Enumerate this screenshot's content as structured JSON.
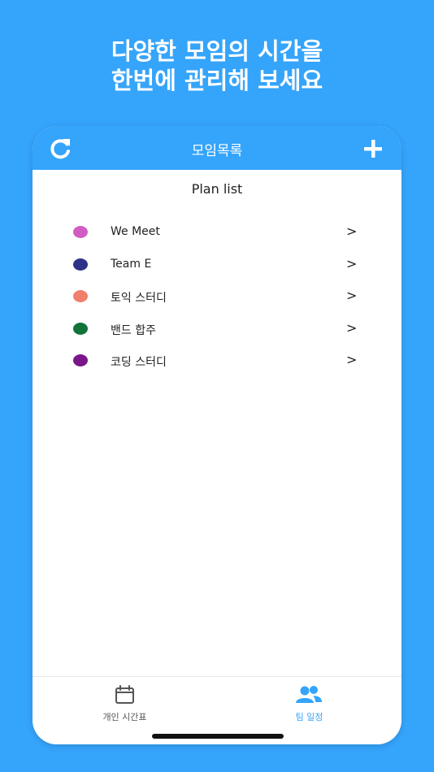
{
  "promo": {
    "line1": "다양한 모임의 시간을",
    "line2": "한번에 관리해 보세요"
  },
  "header": {
    "title": "모임목록",
    "left_icon": "refresh-icon",
    "right_icon": "plus-icon"
  },
  "list": {
    "title": "Plan list",
    "items": [
      {
        "name": "We Meet",
        "color": "#d35cc3",
        "arrow": ">"
      },
      {
        "name": "Team E",
        "color": "#2f3388",
        "arrow": ">"
      },
      {
        "name": "토익 스터디",
        "color": "#f07f6b",
        "arrow": ">"
      },
      {
        "name": "밴드 합주",
        "color": "#11733a",
        "arrow": ">"
      },
      {
        "name": "코딩 스터디",
        "color": "#7a168a",
        "arrow": ">"
      }
    ]
  },
  "tabs": [
    {
      "label": "개인 시간표",
      "icon": "calendar-icon",
      "active": false,
      "color": "#555555"
    },
    {
      "label": "팀 일정",
      "icon": "people-icon",
      "active": true,
      "color": "#35a4fb"
    }
  ],
  "colors": {
    "background": "#35a4fb",
    "accent": "#35a4fb"
  }
}
